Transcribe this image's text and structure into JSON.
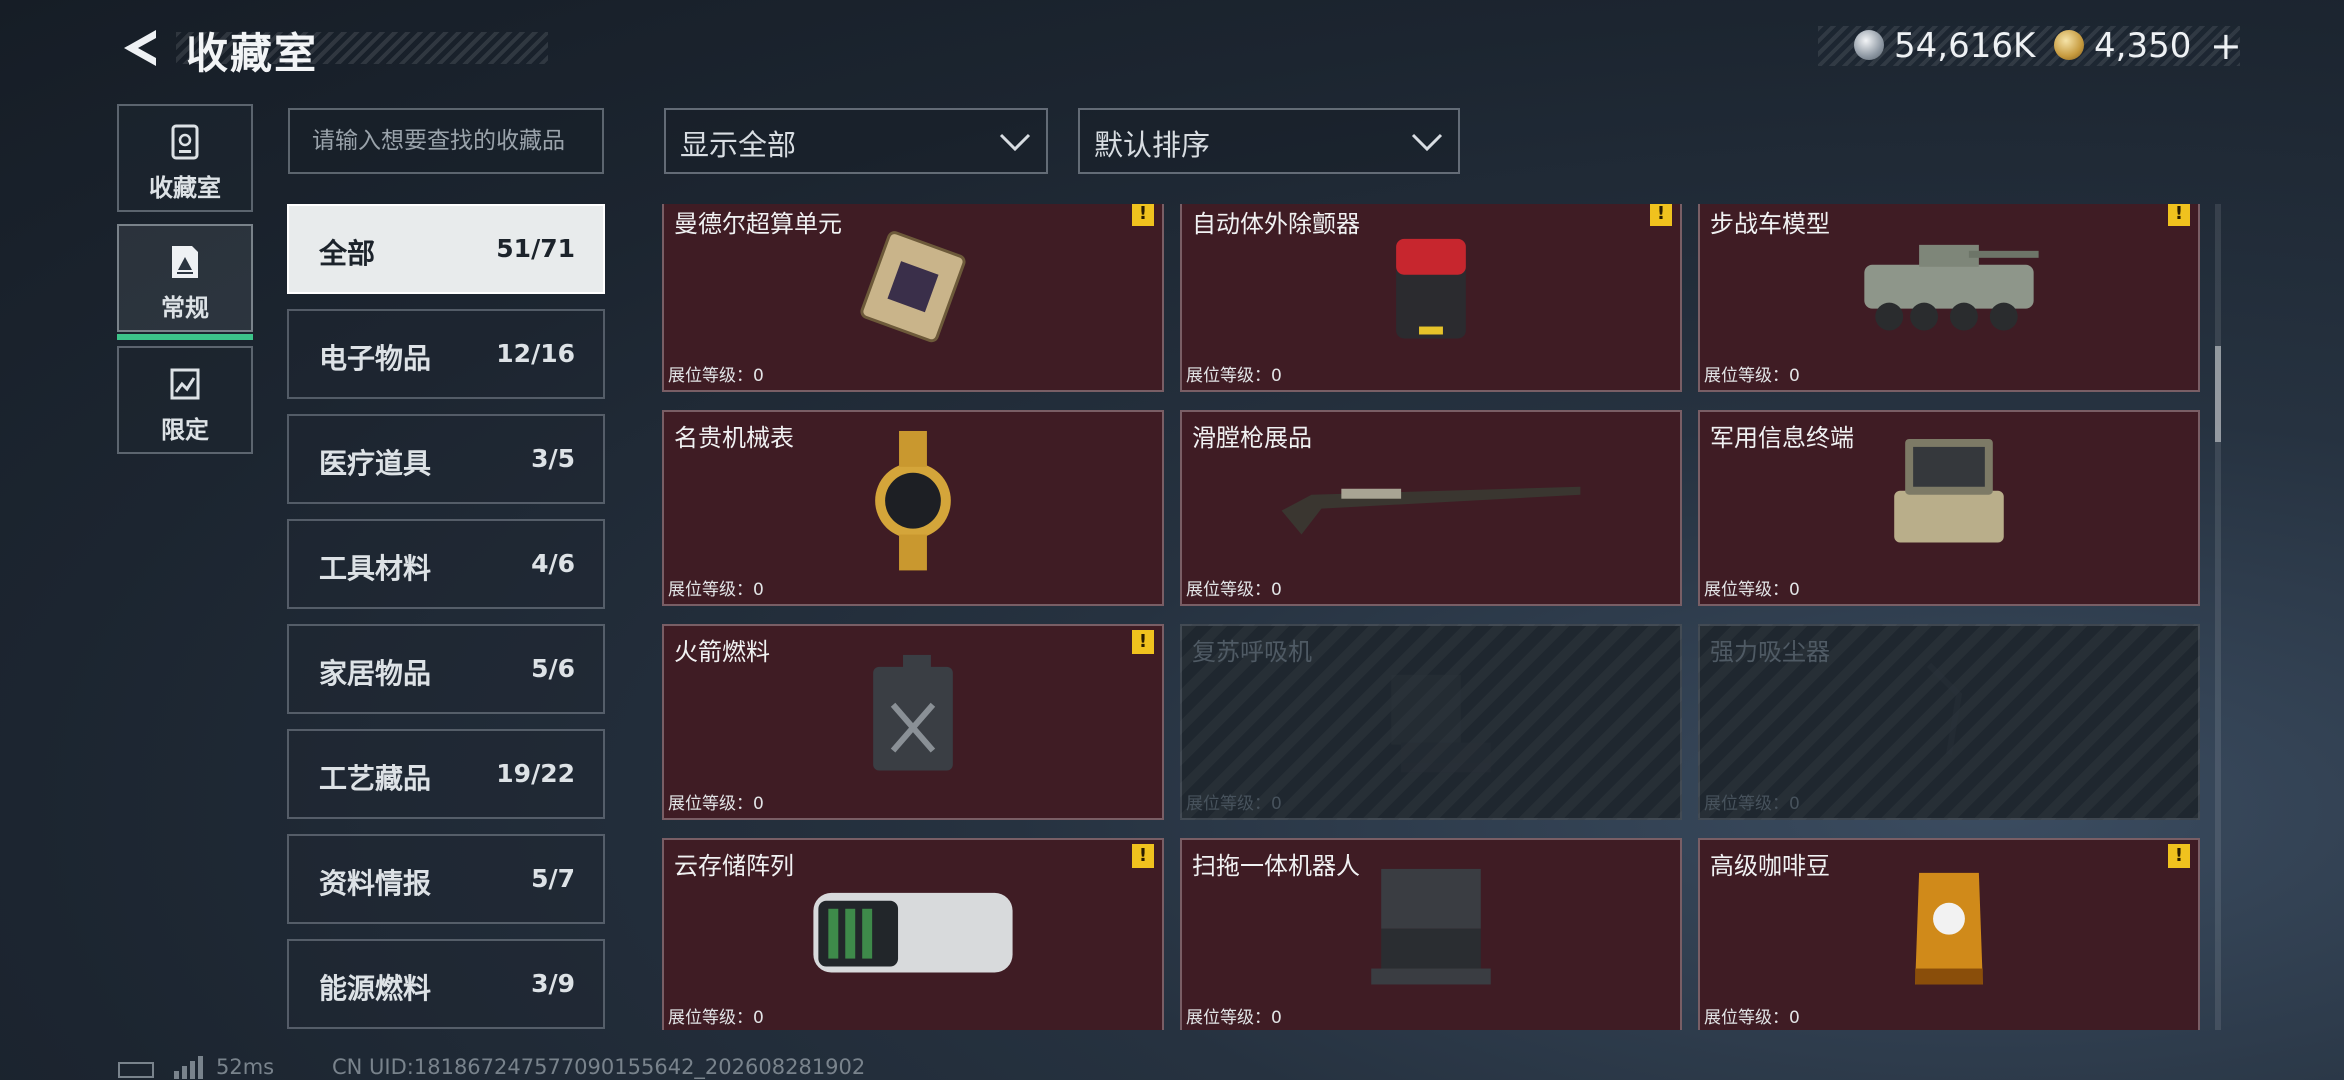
{
  "header": {
    "title": "收藏室",
    "currency_1": "54,616K",
    "currency_2": "4,350",
    "add_symbol": "+"
  },
  "nav": [
    {
      "label": "收藏室",
      "icon": "vault-icon"
    },
    {
      "label": "常规",
      "icon": "regular-collection-icon",
      "active": true
    },
    {
      "label": "限定",
      "icon": "limited-collection-icon"
    }
  ],
  "search": {
    "placeholder": "请输入想要查找的收藏品"
  },
  "filters": {
    "show": "显示全部",
    "sort": "默认排序"
  },
  "categories": [
    {
      "name": "全部",
      "count": "51/71",
      "active": true
    },
    {
      "name": "电子物品",
      "count": "12/16"
    },
    {
      "name": "医疗道具",
      "count": "3/5"
    },
    {
      "name": "工具材料",
      "count": "4/6"
    },
    {
      "name": "家居物品",
      "count": "5/6"
    },
    {
      "name": "工艺藏品",
      "count": "19/22"
    },
    {
      "name": "资料情报",
      "count": "5/7"
    },
    {
      "name": "能源燃料",
      "count": "3/9"
    }
  ],
  "items": [
    {
      "name": "曼德尔超算单元",
      "level": "展位等级：0",
      "warn": true,
      "locked": false
    },
    {
      "name": "自动体外除颤器",
      "level": "展位等级：0",
      "warn": true,
      "locked": false
    },
    {
      "name": "步战车模型",
      "level": "展位等级：0",
      "warn": true,
      "locked": false
    },
    {
      "name": "名贵机械表",
      "level": "展位等级：0",
      "warn": false,
      "locked": false
    },
    {
      "name": "滑膛枪展品",
      "level": "展位等级：0",
      "warn": false,
      "locked": false
    },
    {
      "name": "军用信息终端",
      "level": "展位等级：0",
      "warn": false,
      "locked": false
    },
    {
      "name": "火箭燃料",
      "level": "展位等级：0",
      "warn": true,
      "locked": false
    },
    {
      "name": "复苏呼吸机",
      "level": "展位等级：0",
      "warn": false,
      "locked": true
    },
    {
      "name": "强力吸尘器",
      "level": "展位等级：0",
      "warn": false,
      "locked": true
    },
    {
      "name": "云存储阵列",
      "level": "展位等级：0",
      "warn": true,
      "locked": false
    },
    {
      "name": "扫拖一体机器人",
      "level": "展位等级：0",
      "warn": false,
      "locked": false
    },
    {
      "name": "高级咖啡豆",
      "level": "展位等级：0",
      "warn": true,
      "locked": false
    }
  ],
  "warn_symbol": "!",
  "footer": {
    "ping": "52ms",
    "uid": "CN UID:181867247577090155642_202608281902"
  },
  "colors": {
    "accent": "#3cc48a",
    "card_bg": "#3f1c24",
    "warn": "#f0c21e"
  }
}
